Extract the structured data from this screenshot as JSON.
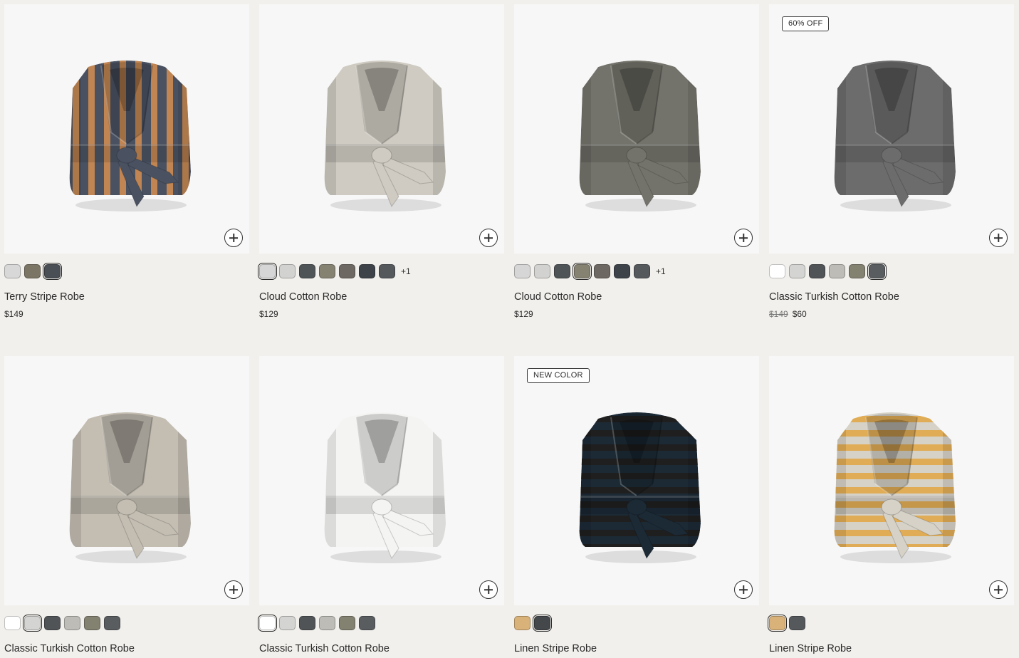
{
  "products": [
    {
      "name": "Terry Stripe Robe",
      "price": "$149",
      "badge": "",
      "robe": {
        "base": "#4a5262",
        "stripe": "#c08552",
        "pattern": "stripes-v"
      },
      "swatches": [
        "#d8d8d8",
        "#7b7565",
        "#4a4f55"
      ],
      "selected_swatch": 2,
      "more": ""
    },
    {
      "name": "Cloud Cotton Robe",
      "price": "$129",
      "badge": "",
      "robe": {
        "base": "#cfcbc2",
        "stripe": "",
        "pattern": "plain"
      },
      "swatches": [
        "#d6d6d6",
        "#d2d2d0",
        "#4f5457",
        "#858272",
        "#6e6863",
        "#3e434a",
        "#55595c"
      ],
      "selected_swatch": 0,
      "more": "+1"
    },
    {
      "name": "Cloud Cotton Robe",
      "price": "$129",
      "badge": "",
      "robe": {
        "base": "#74736b",
        "stripe": "",
        "pattern": "plain"
      },
      "swatches": [
        "#d6d6d6",
        "#d2d2d0",
        "#4f5457",
        "#858272",
        "#6e6863",
        "#3e434a",
        "#55595c"
      ],
      "selected_swatch": 3,
      "more": "+1"
    },
    {
      "name": "Classic Turkish Cotton Robe",
      "price_old": "$149",
      "price": "$60",
      "badge": "60% OFF",
      "robe": {
        "base": "#6b6c6b",
        "stripe": "",
        "pattern": "plain"
      },
      "swatches": [
        "#ffffff",
        "#d4d4d2",
        "#505457",
        "#bdbcb7",
        "#838170",
        "#595d60"
      ],
      "selected_swatch": 5,
      "more": ""
    },
    {
      "name": "Classic Turkish Cotton Robe",
      "price": "",
      "badge": "",
      "robe": {
        "base": "#c3bdb2",
        "stripe": "",
        "pattern": "plain"
      },
      "swatches": [
        "#ffffff",
        "#d4d4d2",
        "#505457",
        "#bdbcb7",
        "#838170",
        "#595d60"
      ],
      "selected_swatch": 1,
      "more": ""
    },
    {
      "name": "Classic Turkish Cotton Robe",
      "price": "",
      "badge": "",
      "robe": {
        "base": "#f4f4f2",
        "stripe": "",
        "pattern": "plain"
      },
      "swatches": [
        "#ffffff",
        "#d4d4d2",
        "#505457",
        "#bdbcb7",
        "#838170",
        "#595d60"
      ],
      "selected_swatch": 0,
      "more": ""
    },
    {
      "name": "Linen Stripe Robe",
      "price": "",
      "badge": "NEW COLOR",
      "robe": {
        "base": "#1c2a36",
        "stripe": "#1f1f1f",
        "pattern": "stripes-h"
      },
      "swatches": [
        "#d9b27a",
        "#45484b"
      ],
      "selected_swatch": 1,
      "more": ""
    },
    {
      "name": "Linen Stripe Robe",
      "price": "",
      "badge": "",
      "robe": {
        "base": "#d6d2c8",
        "stripe": "#e0ac55",
        "pattern": "stripes-h"
      },
      "swatches": [
        "#d9b27a",
        "#55595c"
      ],
      "selected_swatch": 0,
      "more": ""
    }
  ]
}
